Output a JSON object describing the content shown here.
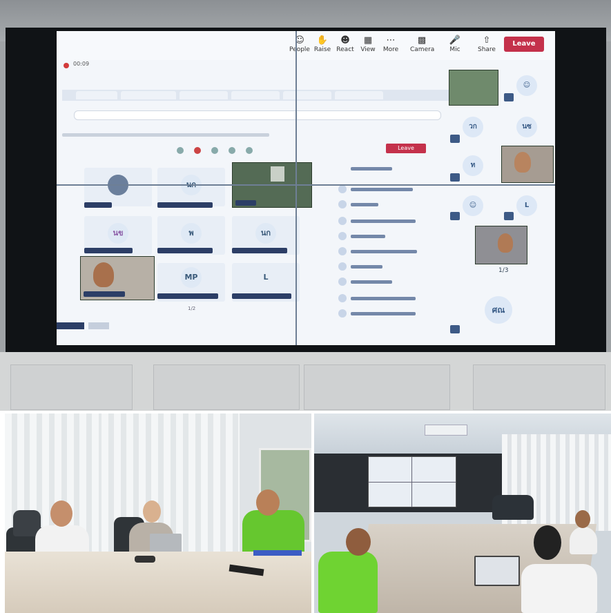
{
  "wall_screen": {
    "window_title": "00:09",
    "toolbar": [
      {
        "label": "People",
        "icon": "people-icon"
      },
      {
        "label": "Raise",
        "icon": "raise-hand-icon"
      },
      {
        "label": "React",
        "icon": "react-icon"
      },
      {
        "label": "View",
        "icon": "view-icon"
      },
      {
        "label": "More",
        "icon": "more-icon"
      },
      {
        "label": "Camera",
        "icon": "camera-icon"
      },
      {
        "label": "Mic",
        "icon": "mic-icon"
      },
      {
        "label": "Share",
        "icon": "share-icon"
      }
    ],
    "leave_label": "Leave",
    "inner_leave_label": "Leave",
    "tiles": [
      "นก",
      "นข",
      "พ",
      "นก",
      "MP",
      "L"
    ],
    "right_tiles": [
      "วก",
      "นซ",
      "ท",
      "L",
      "ศณ"
    ],
    "page_indicator": "1/3",
    "inner_page_indicator": "1/2"
  }
}
